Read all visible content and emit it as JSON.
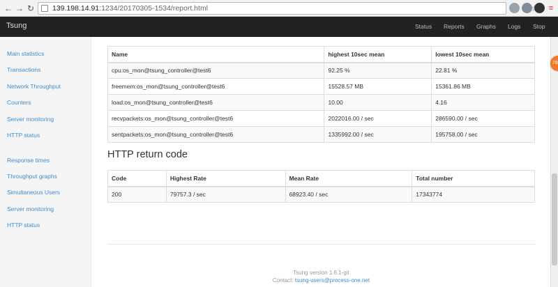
{
  "browser": {
    "url_host": "139.198.14.91",
    "url_rest": ":1234/20170305-1534/report.html",
    "back_icon": "arrow-left",
    "forward_icon": "arrow-right",
    "reload_icon": "reload"
  },
  "navbar": {
    "brand": "Tsung",
    "links": [
      "Status",
      "Reports",
      "Graphs",
      "Logs",
      "Stop"
    ]
  },
  "sidebar": {
    "reports": [
      "Main statistics",
      "Transactions",
      "Network Throughput",
      "Counters",
      "Server monitoring",
      "HTTP status"
    ],
    "graphs": [
      "Response times",
      "Throughput graphs",
      "Simultaneous Users",
      "Server monitoring",
      "HTTP status"
    ]
  },
  "monitor_table": {
    "headers": [
      "Name",
      "highest 10sec mean",
      "lowest 10sec mean"
    ],
    "rows": [
      [
        "cpu:os_mon@tsung_controller@test6",
        "92.25 %",
        "22.81 %"
      ],
      [
        "freemem:os_mon@tsung_controller@test6",
        "15528.57 MB",
        "15361.86 MB"
      ],
      [
        "load:os_mon@tsung_controller@test6",
        "10.00",
        "4.16"
      ],
      [
        "recvpackets:os_mon@tsung_controller@test6",
        "2022016.00 / sec",
        "286590.00 / sec"
      ],
      [
        "sentpackets:os_mon@tsung_controller@test6",
        "1335992.00 / sec",
        "195758.00 / sec"
      ]
    ]
  },
  "http_section": {
    "title": "HTTP return code",
    "headers": [
      "Code",
      "Highest Rate",
      "Mean Rate",
      "Total number"
    ],
    "rows": [
      [
        "200",
        "79757.3 / sec",
        "68923.40 / sec",
        "17343774"
      ]
    ]
  },
  "footer": {
    "version": "Tsung version 1.6.1-git",
    "contact_label": "Contact:",
    "contact_email": "tsung-users@process-one.net"
  },
  "badge_text": "78",
  "colors": {
    "navbar_bg": "#222222",
    "link": "#428bca",
    "badge": "#f07a2a"
  }
}
